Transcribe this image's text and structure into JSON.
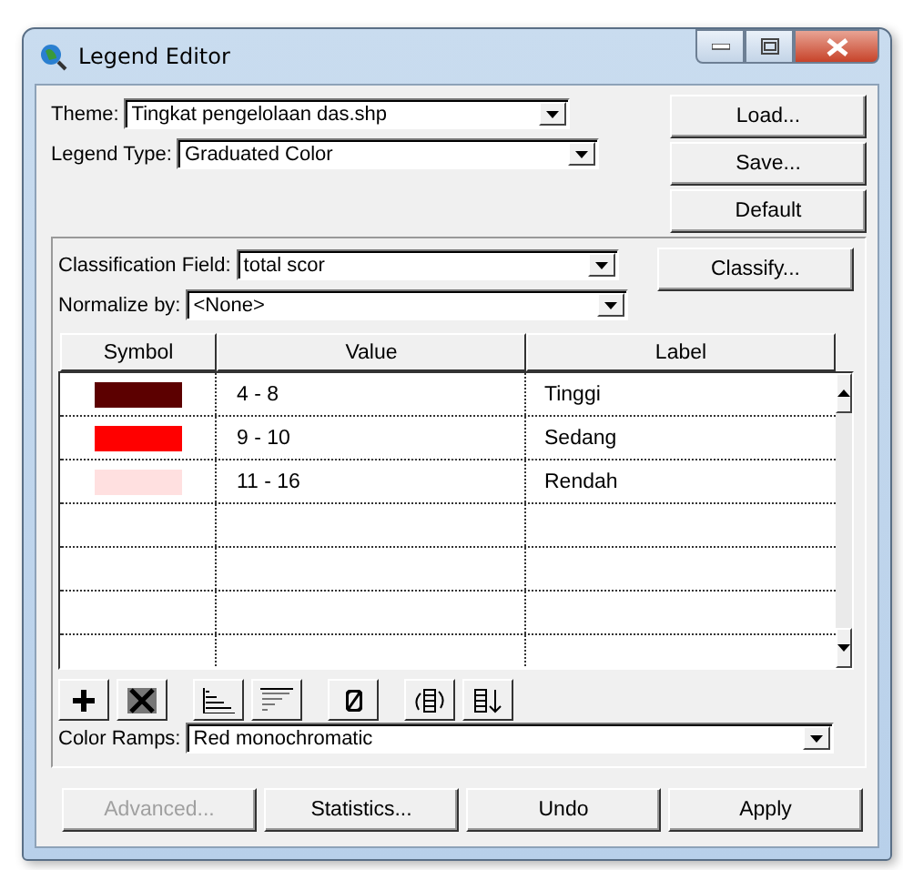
{
  "window": {
    "title": "Legend Editor"
  },
  "theme": {
    "label": "Theme:",
    "value": "Tingkat pengelolaan das.shp"
  },
  "legend_type": {
    "label": "Legend Type:",
    "value": "Graduated Color"
  },
  "side_buttons": [
    {
      "label": "Load..."
    },
    {
      "label": "Save..."
    },
    {
      "label": "Default"
    }
  ],
  "classification_field": {
    "label": "Classification Field:",
    "value": "total scor"
  },
  "classify_button": {
    "label": "Classify..."
  },
  "normalize_by": {
    "label": "Normalize by:",
    "value": "<None>"
  },
  "table": {
    "columns": [
      "Symbol",
      "Value",
      "Label"
    ],
    "rows": [
      {
        "color": "#5c0000",
        "value": "4 - 8",
        "label": "Tinggi"
      },
      {
        "color": "#ff0000",
        "value": "9 - 10",
        "label": "Sedang"
      },
      {
        "color": "#ffe0e0",
        "value": "11 - 16",
        "label": "Rendah"
      }
    ]
  },
  "color_ramps": {
    "label": "Color Ramps:",
    "value": "Red monochromatic"
  },
  "bottom_buttons": [
    {
      "label": "Advanced...",
      "disabled": true
    },
    {
      "label": "Statistics...",
      "disabled": false
    },
    {
      "label": "Undo",
      "disabled": false
    },
    {
      "label": "Apply",
      "disabled": false
    }
  ]
}
